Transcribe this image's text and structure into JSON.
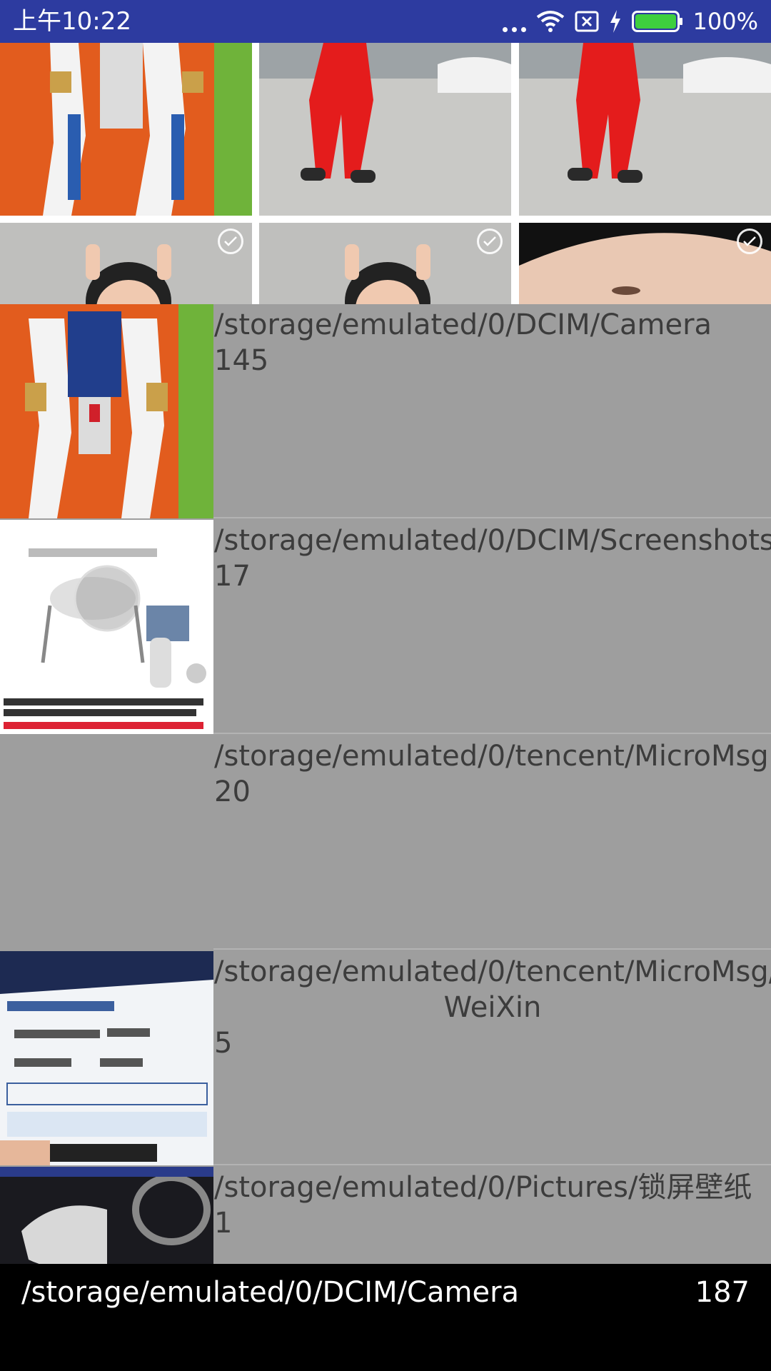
{
  "status_bar": {
    "time": "上午10:22",
    "battery": "100%",
    "icons": [
      "more-dots-icon",
      "wifi-icon",
      "no-sim-icon",
      "charging-icon",
      "battery-icon"
    ]
  },
  "albums": [
    {
      "path": "/storage/emulated/0/DCIM/Camera",
      "count": "145"
    },
    {
      "path": "/storage/emulated/0/DCIM/Screenshots",
      "count": "17"
    },
    {
      "path": "/storage/emulated/0/tencent/MicroMsg",
      "count": "20"
    },
    {
      "path": "/storage/emulated/0/tencent/MicroMsg/",
      "path_cont": "WeiXin",
      "count": "5"
    },
    {
      "path": "/storage/emulated/0/Pictures/锁屏壁纸",
      "count": "1"
    }
  ],
  "bottom_bar": {
    "current_folder": "/storage/emulated/0/DCIM/Camera",
    "total": "187"
  },
  "colors": {
    "status_bar": "#2d3ba0",
    "album_list_bg": "#9e9e9e",
    "bottom_bar": "#000000"
  }
}
